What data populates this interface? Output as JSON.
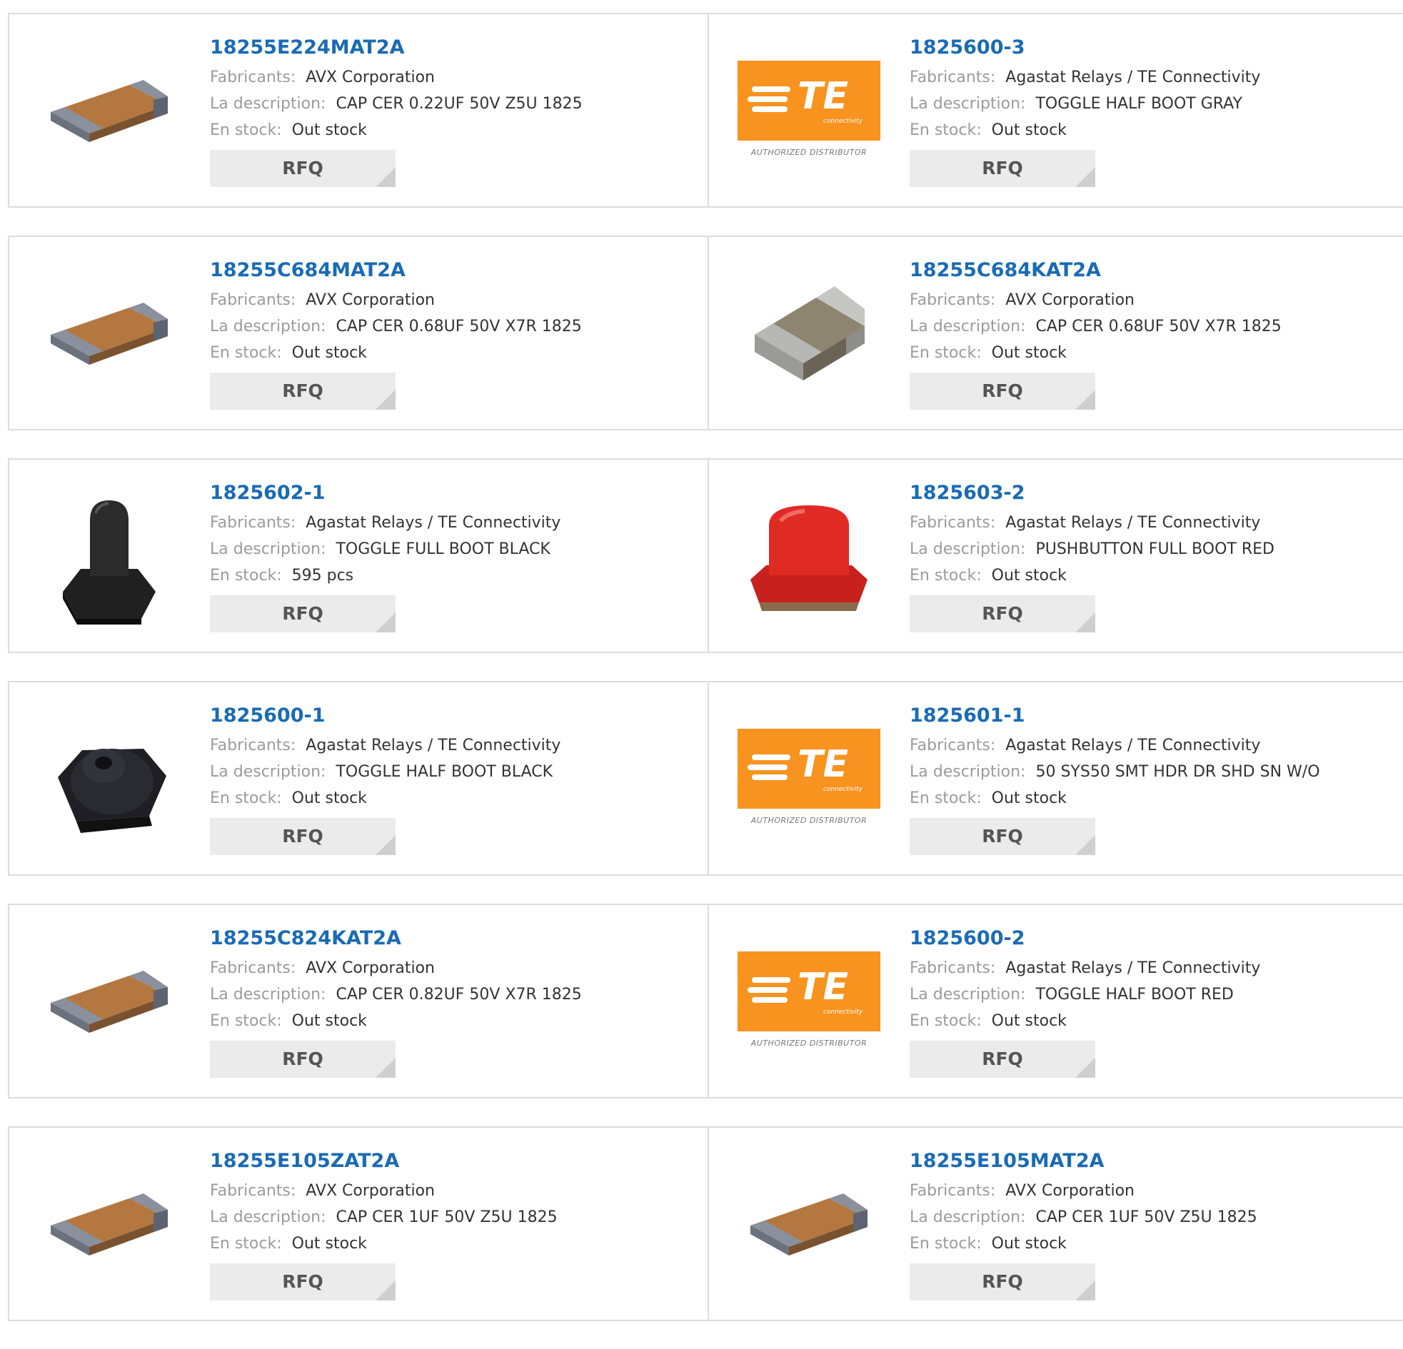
{
  "labels": {
    "manufacturer": "Fabricants:",
    "description": "La description:",
    "stock": "En stock:",
    "rfq": "RFQ"
  },
  "logo": {
    "wordmark": "TE",
    "subtext": "connectivity",
    "caption": "AUTHORIZED DISTRIBUTOR",
    "brand_color": "#f7931e"
  },
  "colors": {
    "link": "#1a6bb5",
    "label": "#9b9b9b",
    "border": "#dcdcdc",
    "button_bg": "#ebebeb"
  },
  "products": [
    {
      "part": "18255E224MAT2A",
      "manufacturer": "AVX Corporation",
      "description": "CAP CER 0.22UF 50V Z5U 1825",
      "stock": "Out stock",
      "image": "ceramic-chip-flat-icon"
    },
    {
      "part": "1825600-3",
      "manufacturer": "Agastat Relays / TE Connectivity",
      "description": "TOGGLE HALF BOOT GRAY",
      "stock": "Out stock",
      "image": "te-logo"
    },
    {
      "part": "18255C684MAT2A",
      "manufacturer": "AVX Corporation",
      "description": "CAP CER 0.68UF 50V X7R 1825",
      "stock": "Out stock",
      "image": "ceramic-chip-flat-icon"
    },
    {
      "part": "18255C684KAT2A",
      "manufacturer": "AVX Corporation",
      "description": "CAP CER 0.68UF 50V X7R 1825",
      "stock": "Out stock",
      "image": "ceramic-chip-block-icon"
    },
    {
      "part": "1825602-1",
      "manufacturer": "Agastat Relays / TE Connectivity",
      "description": "TOGGLE FULL BOOT BLACK",
      "stock": "595 pcs",
      "image": "black-full-boot-icon"
    },
    {
      "part": "1825603-2",
      "manufacturer": "Agastat Relays / TE Connectivity",
      "description": "PUSHBUTTON FULL BOOT RED",
      "stock": "Out stock",
      "image": "red-boot-icon"
    },
    {
      "part": "1825600-1",
      "manufacturer": "Agastat Relays / TE Connectivity",
      "description": "TOGGLE HALF BOOT BLACK",
      "stock": "Out stock",
      "image": "black-half-boot-icon"
    },
    {
      "part": "1825601-1",
      "manufacturer": "Agastat Relays / TE Connectivity",
      "description": "50 SYS50 SMT HDR DR SHD SN W/O",
      "stock": "Out stock",
      "image": "te-logo"
    },
    {
      "part": "18255C824KAT2A",
      "manufacturer": "AVX Corporation",
      "description": "CAP CER 0.82UF 50V X7R 1825",
      "stock": "Out stock",
      "image": "ceramic-chip-flat-icon"
    },
    {
      "part": "1825600-2",
      "manufacturer": "Agastat Relays / TE Connectivity",
      "description": "TOGGLE HALF BOOT RED",
      "stock": "Out stock",
      "image": "te-logo"
    },
    {
      "part": "18255E105ZAT2A",
      "manufacturer": "AVX Corporation",
      "description": "CAP CER 1UF 50V Z5U 1825",
      "stock": "Out stock",
      "image": "ceramic-chip-flat-icon"
    },
    {
      "part": "18255E105MAT2A",
      "manufacturer": "AVX Corporation",
      "description": "CAP CER 1UF 50V Z5U 1825",
      "stock": "Out stock",
      "image": "ceramic-chip-flat-icon"
    }
  ]
}
